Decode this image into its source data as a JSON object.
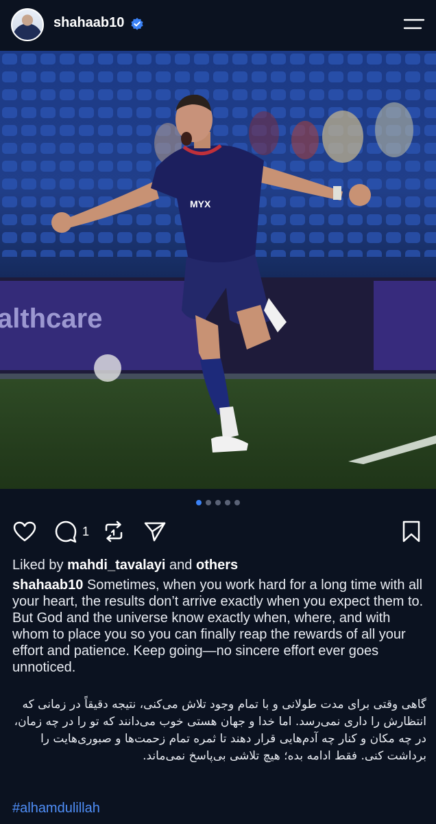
{
  "header": {
    "username": "shahaab10",
    "verified": true,
    "avatar_icon": "profile-avatar",
    "menu_icon": "hamburger-menu-icon"
  },
  "post": {
    "image": {
      "description_icon": "football-celebration-photo",
      "banner_text": "althcare",
      "jersey_text": "MYX"
    },
    "carousel": {
      "total": 5,
      "active_index": 0
    },
    "actions": {
      "comment_count": "1",
      "icons": [
        "heart-icon",
        "comment-icon",
        "repost-icon",
        "send-icon",
        "bookmark-icon"
      ]
    },
    "liked_by": {
      "prefix": "Liked by",
      "user": "mahdi_tavalayi",
      "and": "and",
      "others": "others"
    },
    "caption": {
      "username": "shahaab10",
      "text": "Sometimes, when you work hard for a long time with all your heart, the results don’t arrive exactly when you expect them to. But God and the universe know exactly when, where, and with whom to place you so you can finally reap the rewards of all your effort and patience. Keep going—no sincere effort ever goes unnoticed.",
      "persian": "گاهی وقتی برای مدت طولانی و با تمام وجود تلاش می‌کنی، نتیجه دقیقاً در زمانی که انتظارش را داری نمی‌رسد. اما خدا و جهان هستی خوب می‌دانند که تو را در چه زمان، در چه مکان و کنار چه آدم‌هایی قرار دهند تا ثمره تمام زحمت‌ها و صبوری‌هایت را برداشت کنی. فقط ادامه بده؛ هیچ تلاشی بی‌پاسخ نمی‌ماند."
    },
    "hashtag": "#alhamdulillah"
  },
  "colors": {
    "background": "#0b1220",
    "link": "#4f8ef7",
    "dot_active": "#3b82f6",
    "verified": "#3b82f6"
  }
}
